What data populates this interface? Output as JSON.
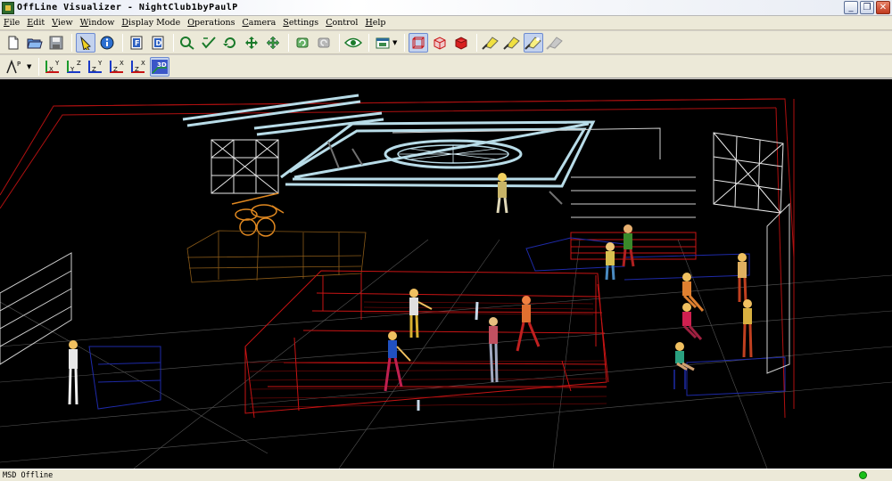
{
  "window": {
    "title": "OffLine Visualizer - NightClub1byPaulP",
    "buttons": {
      "minimize": "_",
      "restore": "❐",
      "close": "✕"
    }
  },
  "menu": [
    {
      "acc": "F",
      "rest": "ile"
    },
    {
      "acc": "E",
      "rest": "dit"
    },
    {
      "acc": "V",
      "rest": "iew"
    },
    {
      "acc": "W",
      "rest": "indow"
    },
    {
      "acc": "D",
      "rest": "isplay Mode"
    },
    {
      "acc": "O",
      "rest": "perations"
    },
    {
      "acc": "C",
      "rest": "amera"
    },
    {
      "acc": "S",
      "rest": "ettings"
    },
    {
      "acc": "C",
      "rest": "ontrol"
    },
    {
      "acc": "H",
      "rest": "elp"
    }
  ],
  "toolbar1": {
    "icons": [
      "new-file-icon",
      "open-folder-icon",
      "save-icon",
      "pointer-icon",
      "info-icon",
      "f-page-icon",
      "d-page-icon",
      "zoom-icon",
      "select-icon",
      "rotate-icon",
      "move-icon",
      "pan-icon",
      "undo-view-icon",
      "redo-view-icon",
      "eye-icon",
      "camera-window-icon",
      "wireframe-icon",
      "box-outline-icon",
      "solid-box-icon",
      "spotlight-icon",
      "spotlight-beam-icon",
      "light-on-icon",
      "light-off-icon"
    ]
  },
  "toolbar2": {
    "labels": {
      "m": "M",
      "p": "P",
      "xy": [
        "X",
        "Y"
      ],
      "yz": [
        "Y",
        "Z"
      ],
      "zy": [
        "Z",
        "Y"
      ],
      "zx": [
        "Z",
        "X"
      ],
      "zx2": [
        "Z",
        "X"
      ],
      "three_d": "3D"
    }
  },
  "status": {
    "text": "MSD Offline",
    "led_color": "#18c018"
  },
  "colors": {
    "wire_red": "#c81414",
    "wire_white": "#e8e8e8",
    "truss": "#b8dce8",
    "wire_blue": "#1e2aa8",
    "wire_orange": "#b06a18"
  }
}
